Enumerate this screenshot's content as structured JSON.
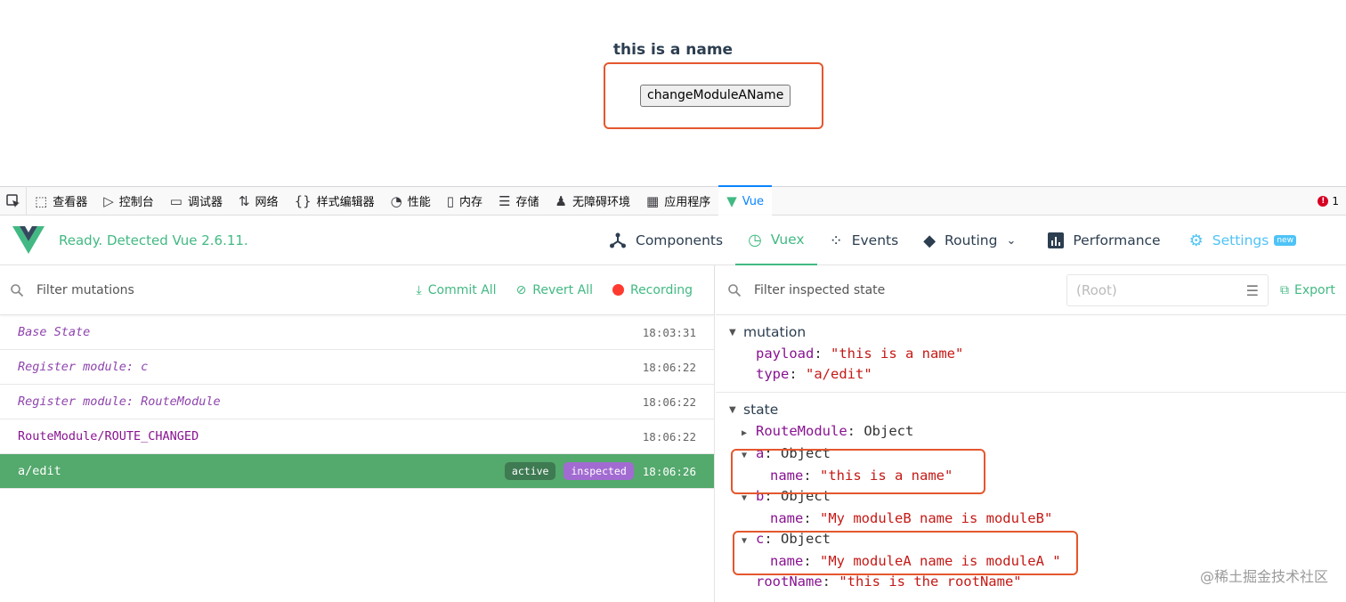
{
  "page": {
    "title": "this is a name",
    "button_label": "changeModuleAName"
  },
  "devtools_tabs": [
    {
      "label": "查看器",
      "icon": "inspector-icon",
      "glyph": "⬚"
    },
    {
      "label": "控制台",
      "icon": "console-icon",
      "glyph": "▷"
    },
    {
      "label": "调试器",
      "icon": "debugger-icon",
      "glyph": "▭"
    },
    {
      "label": "网络",
      "icon": "network-icon",
      "glyph": "⇅"
    },
    {
      "label": "样式编辑器",
      "icon": "style-editor-icon",
      "glyph": "{}"
    },
    {
      "label": "性能",
      "icon": "performance-icon",
      "glyph": "◔"
    },
    {
      "label": "内存",
      "icon": "memory-icon",
      "glyph": "▯"
    },
    {
      "label": "存储",
      "icon": "storage-icon",
      "glyph": "☰"
    },
    {
      "label": "无障碍环境",
      "icon": "accessibility-icon",
      "glyph": "♟"
    },
    {
      "label": "应用程序",
      "icon": "application-icon",
      "glyph": "▦"
    },
    {
      "label": "Vue",
      "icon": "vue-icon",
      "glyph": "▼",
      "active": true
    }
  ],
  "error_count": "1",
  "vue": {
    "status": "Ready. Detected Vue 2.6.11.",
    "nav": {
      "components": "Components",
      "vuex": "Vuex",
      "events": "Events",
      "routing": "Routing",
      "performance": "Performance",
      "settings": "Settings",
      "new_badge": "new"
    }
  },
  "mutations_panel": {
    "filter_placeholder": "Filter mutations",
    "commit_all": "Commit All",
    "revert_all": "Revert All",
    "recording": "Recording",
    "items": [
      {
        "name": "Base State",
        "time": "18:03:31",
        "italic": true
      },
      {
        "name": "Register module: c",
        "time": "18:06:22",
        "italic": true
      },
      {
        "name": "Register module: RouteModule",
        "time": "18:06:22",
        "italic": true
      },
      {
        "name": "RouteModule/ROUTE_CHANGED",
        "time": "18:06:22",
        "italic": false
      },
      {
        "name": "a/edit",
        "time": "18:06:26",
        "italic": false,
        "selected": true
      }
    ],
    "badge_active": "active",
    "badge_inspected": "inspected"
  },
  "state_panel": {
    "filter_placeholder": "Filter inspected state",
    "root_select": "(Root)",
    "export": "Export",
    "mutation_title": "mutation",
    "payload_key": "payload",
    "payload_value": "\"this is a name\"",
    "type_key": "type",
    "type_value": "\"a/edit\"",
    "state_title": "state",
    "route_module_key": "RouteModule",
    "object_label": "Object",
    "a_key": "a",
    "a_name_key": "name",
    "a_name_value": "\"this is a name\"",
    "b_key": "b",
    "b_name_key": "name",
    "b_name_value": "\"My moduleB name is moduleB\"",
    "c_key": "c",
    "c_name_key": "name",
    "c_name_value": "\"My moduleA name is moduleA \"",
    "root_name_key": "rootName",
    "root_name_value": "\"this is the rootName\""
  },
  "watermark": "@稀土掘金技术社区",
  "colors": {
    "vue_green": "#42b983",
    "selected_row": "#54a96d",
    "annotation": "#e4572e",
    "key_purple": "#881391",
    "string_red": "#c41a16"
  }
}
